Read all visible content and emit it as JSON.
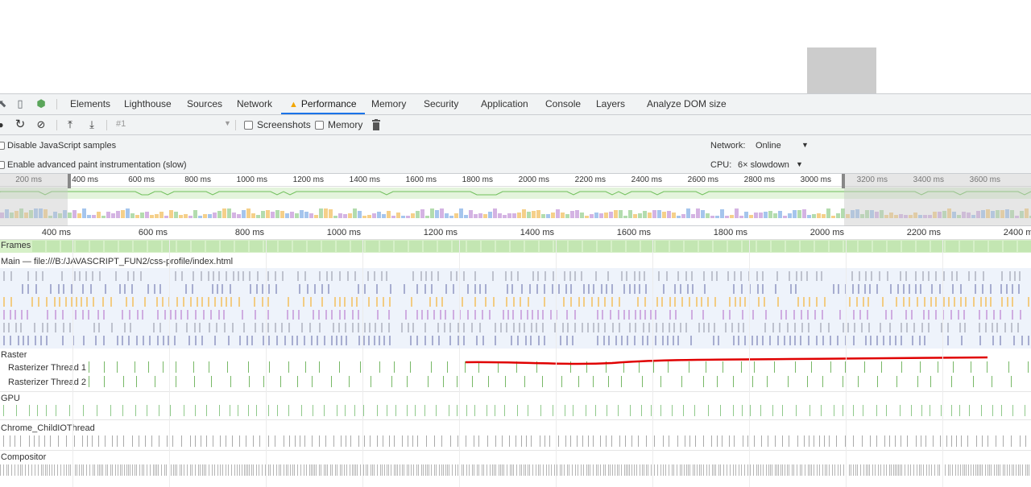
{
  "devtools": {
    "tabs": [
      "Elements",
      "Lighthouse",
      "Sources",
      "Network",
      "Performance",
      "Memory",
      "Security",
      "Application",
      "Console",
      "Layers",
      "Analyze DOM size"
    ],
    "active_tab": "Performance"
  },
  "toolbar": {
    "recording_label": "#1",
    "screenshots_label": "Screenshots",
    "memory_label": "Memory"
  },
  "settings": {
    "disable_js_samples": "Disable JavaScript samples",
    "advanced_paint": "Enable advanced paint instrumentation (slow)",
    "network_label": "Network:",
    "network_value": "Online",
    "cpu_label": "CPU:",
    "cpu_value": "6× slowdown"
  },
  "overview": {
    "ticks": [
      "200 ms",
      "400 ms",
      "600 ms",
      "800 ms",
      "1000 ms",
      "1200 ms",
      "1400 ms",
      "1600 ms",
      "1800 ms",
      "2000 ms",
      "2200 ms",
      "2400 ms",
      "2600 ms",
      "2800 ms",
      "3000 ms",
      "3200 ms",
      "3400 ms",
      "3600 ms"
    ]
  },
  "timeline": {
    "ticks": [
      "400 ms",
      "600 ms",
      "800 ms",
      "1000 ms",
      "1200 ms",
      "1400 ms",
      "1600 ms",
      "1800 ms",
      "2000 ms",
      "2200 ms",
      "2400 ms"
    ]
  },
  "tracks": {
    "frames": "Frames",
    "main": "Main — file:///B:/JAVASCRIPT_FUN2/css-profile/index.html",
    "raster": "Raster",
    "raster1": "Rasterizer Thread 1",
    "raster2": "Rasterizer Thread 2",
    "gpu": "GPU",
    "childio": "Chrome_ChildIOThread",
    "compositor": "Compositor"
  },
  "colors": {
    "accent": "#1a73e8",
    "warning": "#f2a600",
    "annotation": "#e00000"
  }
}
